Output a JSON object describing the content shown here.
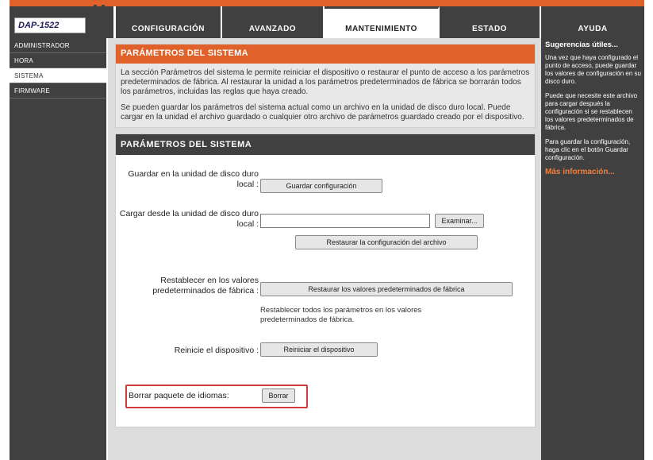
{
  "logo": {
    "text": "DAP-1522"
  },
  "tabs": [
    {
      "label": "CONFIGURACIÓN",
      "active": false
    },
    {
      "label": "AVANZADO",
      "active": false
    },
    {
      "label": "MANTENIMIENTO",
      "active": true
    },
    {
      "label": "ESTADO",
      "active": false
    },
    {
      "label": "AYUDA",
      "active": false
    }
  ],
  "sidebar": {
    "items": [
      {
        "label": "ADMINISTRADOR"
      },
      {
        "label": "HORA"
      },
      {
        "label": "SISTEMA"
      },
      {
        "label": "FIRMWARE"
      }
    ]
  },
  "intro": {
    "title": "PARÁMETROS DEL SISTEMA",
    "para1": "La sección Parámetros del sistema le permite reiniciar el dispositivo o restaurar el punto de acceso a los parámetros predeterminados de fábrica. Al restaurar la unidad a los parámetros predeterminados de fábrica se borrarán todos los parámetros, incluidas las reglas que haya creado.",
    "para2": "Se pueden guardar los parámetros del sistema actual como un archivo en la unidad de disco duro local. Puede cargar en la unidad el archivo guardado o cualquier otro archivo de parámetros guardado creado por el dispositivo."
  },
  "system": {
    "title": "PARÁMETROS DEL SISTEMA",
    "save_label": "Guardar en la unidad de disco duro local :",
    "save_button": "Guardar configuración",
    "load_label": "Cargar desde la unidad de disco duro local :",
    "file_value": "",
    "browse_button": "Examinar...",
    "restore_file_button": "Restaurar la configuración del archivo",
    "defaults_label": "Restablecer en los valores predeterminados de fábrica :",
    "defaults_button": "Restaurar los valores predeterminados de fábrica",
    "defaults_note": "Restablecer todos los parámetros en los valores predeterminados de fábrica.",
    "reboot_label": "Reinicie el dispositivo :",
    "reboot_button": "Reiniciar el dispositivo",
    "erase_label": "Borrar paquete de idiomas:",
    "erase_button": "Borrar"
  },
  "help": {
    "title": "Sugerencias útiles...",
    "p1": "Una vez que haya configurado el punto de acceso, puede guardar los valores de configuración en su disco duro.",
    "p2": "Puede que necesite este archivo para cargar después la configuración si se restablecen los valores predeterminados de fábrica.",
    "p3": "Para guardar la configuración, haga clic en el botón Guardar configuración.",
    "more_link": "Más información..."
  }
}
